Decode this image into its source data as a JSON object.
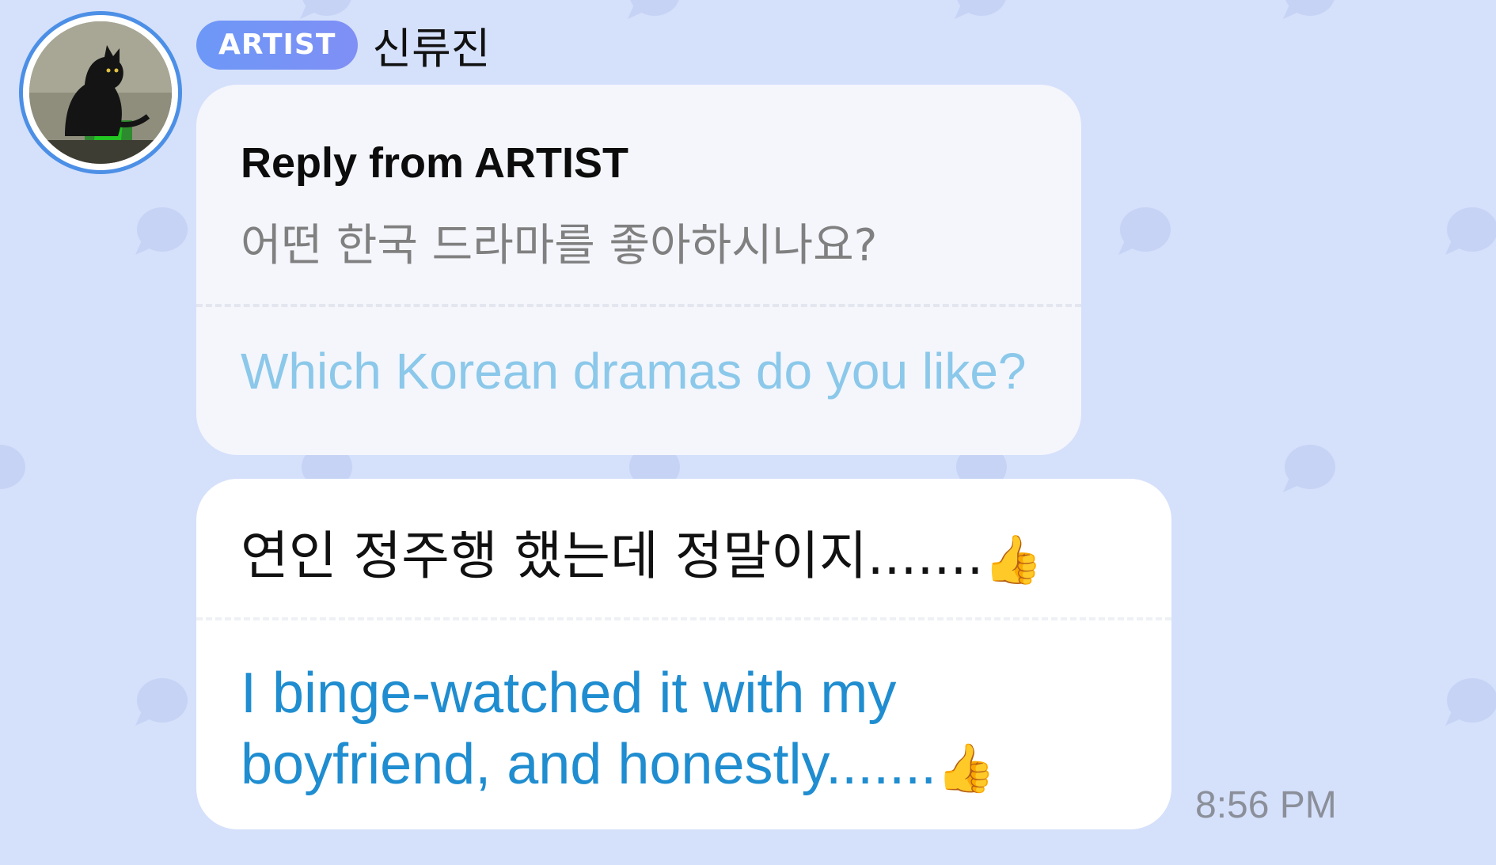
{
  "colors": {
    "background": "#d5e0fb",
    "badge": "#6d98f7",
    "reply_bubble": "#f4f6fc",
    "message_bubble": "#ffffff",
    "translation_light": "#8bc8ea",
    "translation_dark": "#1f8dd0",
    "timestamp": "#8a8f99"
  },
  "sender": {
    "badge": "ARTIST",
    "name": "신류진",
    "avatar_icon": "black-cat-photo"
  },
  "reply": {
    "title": "Reply from ARTIST",
    "original_text": "어떤 한국 드라마를 좋아하시나요?",
    "translated_text": "Which Korean dramas do you like?"
  },
  "message": {
    "original_text": "연인 정주행 했는데 정말이지.......",
    "original_emoji": "👍",
    "translated_text": "I binge-watched it with my boyfriend, and honestly.......",
    "translated_emoji": "👍",
    "timestamp": "8:56 PM"
  }
}
